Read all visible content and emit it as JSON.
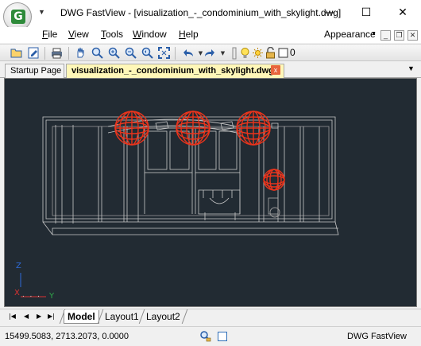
{
  "window": {
    "title": "DWG FastView - [visualization_-_condominium_with_skylight.dwg]",
    "minimize": "—",
    "maximize": "☐",
    "close": "✕",
    "logo_letter": "G",
    "quick_access": "▼"
  },
  "menu": {
    "items": [
      "File",
      "View",
      "Tools",
      "Window",
      "Help"
    ],
    "appearance": "Appearance",
    "appearance_arrow": "▼",
    "mdi_min": "_",
    "mdi_restore": "❐",
    "mdi_close": "✕"
  },
  "toolbar": {
    "icons": [
      "open-folder-icon",
      "save-as-icon",
      "print-icon",
      "pan-hand-icon",
      "zoom-window-icon",
      "zoom-in-icon",
      "zoom-out-icon",
      "zoom-previous-icon",
      "zoom-extents-icon",
      "undo-icon",
      "redo-icon",
      "grip-icon",
      "lightbulb-icon",
      "sun-icon",
      "layer-lock-icon",
      "layer-color-icon"
    ],
    "layer_value": "0"
  },
  "tabs": {
    "start": "Startup Page",
    "active": "visualization_-_condominium_with_skylight.dwg",
    "close": "x",
    "menu_arrow": "▼"
  },
  "canvas": {
    "background": "#222b33",
    "axis_z": "Z",
    "axis_x": "X",
    "axis_y": "Y",
    "axis_dots": ". . ."
  },
  "layout_tabs": {
    "nav": [
      "|◀",
      "◀",
      "▶",
      "▶|"
    ],
    "items": [
      "Model",
      "Layout1",
      "Layout2"
    ]
  },
  "status": {
    "coordinates": "15499.5083, 2713.2073, 0.0000",
    "app_name": "DWG FastView"
  },
  "colors": {
    "accent_tab": "#fff7b8",
    "lamp_red": "#e8341c",
    "drawing_lines": "#c9c9c9"
  }
}
